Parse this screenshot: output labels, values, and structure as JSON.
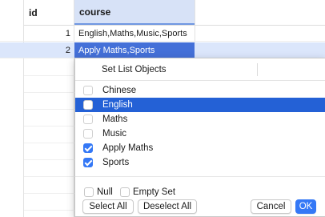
{
  "table": {
    "columns": {
      "id": "id",
      "course": "course"
    },
    "rows": [
      {
        "id": "1",
        "course": "English,Maths,Music,Sports"
      },
      {
        "id": "2",
        "course": "Apply Maths,Sports"
      }
    ]
  },
  "popup": {
    "header": "Set List Objects",
    "options": [
      {
        "label": "Chinese",
        "checked": false
      },
      {
        "label": "English",
        "checked": false
      },
      {
        "label": "Maths",
        "checked": false
      },
      {
        "label": "Music",
        "checked": false
      },
      {
        "label": "Apply Maths",
        "checked": true
      },
      {
        "label": "Sports",
        "checked": true
      }
    ],
    "null_label": "Null",
    "empty_set_label": "Empty Set",
    "buttons": {
      "select_all": "Select All",
      "deselect_all": "Deselect All",
      "cancel": "Cancel",
      "ok": "OK"
    }
  },
  "colors": {
    "accent": "#3478f6",
    "highlight": "#2461d6",
    "selected_cell": "#4470d8"
  }
}
